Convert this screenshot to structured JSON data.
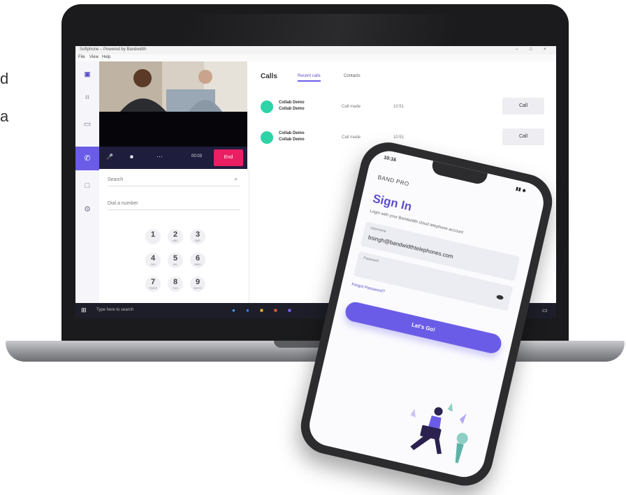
{
  "page": {
    "clipped_text_line1": "d",
    "clipped_text_line2": "a"
  },
  "window": {
    "title": "Softphone – Powered by Bandwidth",
    "controls": [
      "–",
      "□",
      "×"
    ],
    "menu": [
      "File",
      "View",
      "Help"
    ]
  },
  "rail": {
    "icons": [
      "teams-logo-icon",
      "chat-icon",
      "message-icon",
      "phone-icon",
      "calendar-icon",
      "settings-icon"
    ]
  },
  "call_controls": {
    "mute": "🎤",
    "video": "■",
    "more": "···",
    "timer": "00:03",
    "end": "End"
  },
  "dialer": {
    "search_placeholder": "Search",
    "dial_placeholder": "Dial a number",
    "keys": [
      {
        "num": "1",
        "letters": ""
      },
      {
        "num": "2",
        "letters": "ABC"
      },
      {
        "num": "3",
        "letters": "DEF"
      },
      {
        "num": "4",
        "letters": "GHI"
      },
      {
        "num": "5",
        "letters": "JKL"
      },
      {
        "num": "6",
        "letters": "MNO"
      },
      {
        "num": "7",
        "letters": "PQRS"
      },
      {
        "num": "8",
        "letters": "TUV"
      },
      {
        "num": "9",
        "letters": "WXYZ"
      }
    ]
  },
  "calls": {
    "title": "Calls",
    "tabs": [
      "Recent calls",
      "Contacts"
    ],
    "rows": [
      {
        "name": "Collab Demo",
        "subname": "Collab Demo",
        "type": "Call made",
        "time": "10:51",
        "button": "Call"
      },
      {
        "name": "Collab Demo",
        "subname": "Collab Demo",
        "type": "Call made",
        "time": "10:51",
        "button": "Call"
      }
    ]
  },
  "taskbar": {
    "search": "Type here to search"
  },
  "phone": {
    "time": "10:16",
    "brand": "BAND PRO",
    "heading": "Sign In",
    "subtitle": "Login with your Bandwidth cloud telephone account",
    "username_label": "Username",
    "username_value": "bsingh@bandwidthtelephones.com",
    "password_label": "Password",
    "forgot": "Forgot Password?",
    "button": "Let's Go!"
  },
  "colors": {
    "accent": "#6b5ce7",
    "end_call": "#e91e63",
    "avatar": "#2fd3a8",
    "dark_bar": "#1f1d3d"
  }
}
